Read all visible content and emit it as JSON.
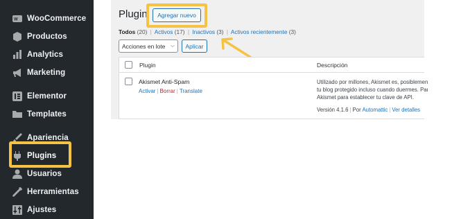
{
  "sidebar": {
    "items": [
      {
        "label": "WooCommerce",
        "icon": "woocommerce-icon"
      },
      {
        "label": "Productos",
        "icon": "box-icon"
      },
      {
        "label": "Analytics",
        "icon": "bar-chart-icon"
      },
      {
        "label": "Marketing",
        "icon": "megaphone-icon"
      },
      {
        "label": "Elementor",
        "icon": "elementor-icon"
      },
      {
        "label": "Templates",
        "icon": "folder-icon"
      },
      {
        "label": "Apariencia",
        "icon": "paintbrush-icon"
      },
      {
        "label": "Plugins",
        "icon": "plug-icon"
      },
      {
        "label": "Usuarios",
        "icon": "user-icon"
      },
      {
        "label": "Herramientas",
        "icon": "wrench-icon"
      },
      {
        "label": "Ajustes",
        "icon": "settings-icon"
      }
    ]
  },
  "header": {
    "title": "Plugin",
    "add_new": "Agregar nuevo"
  },
  "filters": {
    "all": "Todos",
    "all_count": "(20)",
    "active": "Activos",
    "active_count": "(17)",
    "inactive": "Inactivos",
    "inactive_count": "(3)",
    "recent": "Activos recientemente",
    "recent_count": "(3)",
    "separator": "|"
  },
  "bulk": {
    "select_value": "Acciones en lote",
    "apply": "Aplicar"
  },
  "table": {
    "columns": [
      "Plugin",
      "Descripción"
    ],
    "rows": [
      {
        "name": "Akismet Anti-Spam",
        "actions": {
          "activate": "Activar",
          "delete": "Borrar",
          "translate": "Translate"
        },
        "description": [
          "Utilizado por millones, Akismet es, posiblemente,",
          "tu blog protegido incluso cuando duermes. Para",
          "Akismet para establecer tu clave de API."
        ],
        "version": "Versión 4.1.6",
        "by": "Por",
        "author": "Automattic",
        "details": "Ver detalles"
      }
    ]
  },
  "colors": {
    "highlight": "#f5c344",
    "sidebar_bg": "#23282d",
    "link": "#2271b1",
    "delete": "#b32d2e"
  }
}
